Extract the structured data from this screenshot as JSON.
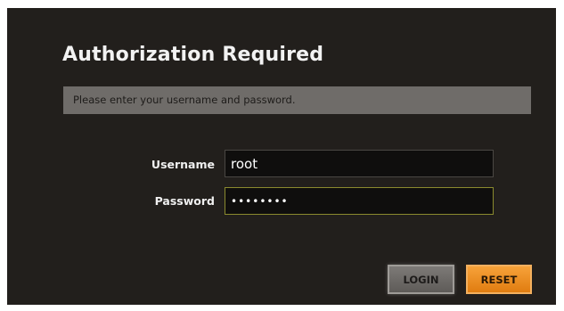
{
  "dialog": {
    "title": "Authorization Required",
    "message": "Please enter your username and password."
  },
  "form": {
    "username_label": "Username",
    "username_value": "root",
    "password_label": "Password",
    "password_value": "••••••••"
  },
  "buttons": {
    "login_label": "LOGIN",
    "reset_label": "RESET"
  },
  "colors": {
    "panel_background": "#221f1c",
    "message_bar": "#6f6c69",
    "reset_accent": "#e88a1e",
    "login_button": "#6e6b68"
  }
}
